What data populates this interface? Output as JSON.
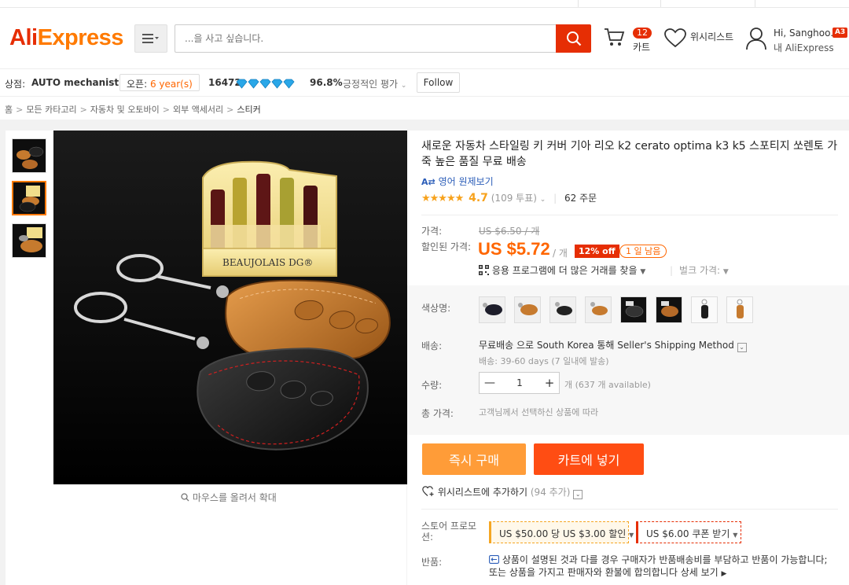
{
  "header": {
    "logo_ali": "Ali",
    "logo_express": "Express",
    "search_placeholder": "...을 사고 싶습니다.",
    "cart_count": "12",
    "cart_label": "카트",
    "wishlist_label": "위시리스트",
    "user_greeting": "Hi, Sanghoo..",
    "user_level": "A3",
    "user_sub": "내 AliExpress"
  },
  "store": {
    "store_label": "상점:",
    "store_name": "AUTO mechanist",
    "open_label": "오픈:",
    "open_years": "6 year(s)",
    "score": "16472",
    "positive_pct": "96.8%",
    "positive_label": "긍정적인 평가",
    "follow_label": "Follow"
  },
  "breadcrumb": [
    "홈",
    "모든 카타고리",
    "자동차 및 오토바이",
    "외부 액세서리",
    "스티커"
  ],
  "gallery": {
    "zoom_hint": "마우스를 올려서 확대",
    "image_caption": "BEAUJOLAIS DG®"
  },
  "product": {
    "title": "새로운 자동차 스타일링 키 커버 기아 리오 k2 cerato optima k3 k5 스포티지 쏘렌토 가죽 높은 품질 무료 배송",
    "translate_label": "영어 원제보기",
    "stars": "★★★★★",
    "rating": "4.7",
    "votes": "(109 투표)",
    "orders": "62 주문",
    "price_label": "가격:",
    "original_price": "US $6.50 / 개",
    "discount_label": "할인된 가격:",
    "sale_price": "US $5.72",
    "per_unit": "/ 개",
    "off_badge": "12% off",
    "days_left": "1 일 남음",
    "app_deal": "응용 프로그램에 더 많은 거래를 찾을",
    "bulk_label": "벌크 가격:"
  },
  "sku": {
    "color_label": "색상명:",
    "shipping_label": "배송:",
    "shipping_main": "무료배송 으로 South Korea 통해 Seller's Shipping Method",
    "shipping_sub": "배송: 39-60 days (7 일내에 발송)",
    "qty_label": "수량:",
    "qty_minus": "—",
    "qty_value": "1",
    "qty_plus": "+",
    "qty_available": "개 (637 개 available)",
    "total_label": "총 가격:",
    "total_value": "고객님께서 선택하신 상품에 따라"
  },
  "actions": {
    "buy_now": "즉시 구매",
    "add_to_cart": "카트에 넣기",
    "add_wishlist": "위시리스트에 추가하기",
    "wishlist_count": "(94 추가)"
  },
  "promo": {
    "store_promo_label": "스토어 프로모션:",
    "coupon1": "US $50.00 당 US $3.00 할인",
    "coupon2": "US $6.00 쿠폰 받기",
    "return_label": "반품:",
    "return_text": "상품이 설명된 것과 다를 경우 구매자가 반품배송비를 부담하고 반품이 가능합니다; 또는 상품을 가지고 판매자와 환불에 합의합니다",
    "return_more": "상세 보기"
  },
  "colors": {
    "brand_red": "#e62e04",
    "brand_orange": "#ff7a00",
    "price_orange": "#ff6600",
    "buy_btn": "#ff9c38",
    "cart_btn": "#ff4d13",
    "link_blue": "#2b5db8",
    "diamond_blue": "#2aa7e8"
  }
}
